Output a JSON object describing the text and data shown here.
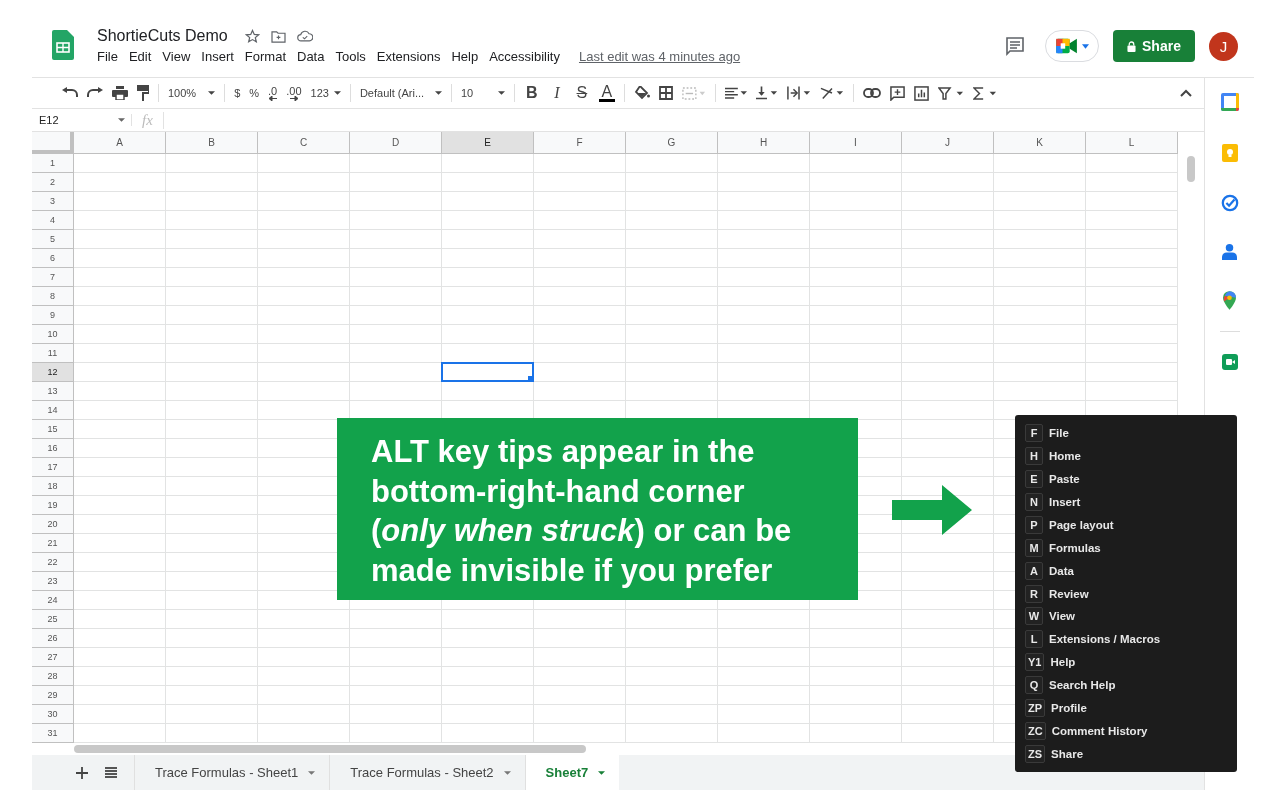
{
  "app": {
    "title": "ShortieCuts Demo",
    "menu": [
      "File",
      "Edit",
      "View",
      "Insert",
      "Format",
      "Data",
      "Tools",
      "Extensions",
      "Help",
      "Accessibility"
    ],
    "last_edit": "Last edit was 4 minutes ago",
    "share_button": "Share",
    "avatar": "J"
  },
  "toolbar": {
    "zoom": "100%",
    "currency": "$",
    "percent": "%",
    "decrease_decimals": ".0",
    "increase_decimals": ".00",
    "more_formats": "123",
    "font": "Default (Ari...",
    "font_size": "10",
    "bold": "B",
    "italic": "I",
    "strikethrough": "S",
    "text_color": "A"
  },
  "formula_bar": {
    "cell_ref": "E12",
    "fx": "fx"
  },
  "columns": [
    {
      "label": "A",
      "selected": false
    },
    {
      "label": "B",
      "selected": false
    },
    {
      "label": "C",
      "selected": false
    },
    {
      "label": "D",
      "selected": false
    },
    {
      "label": "E",
      "selected": true
    },
    {
      "label": "F",
      "selected": false
    },
    {
      "label": "G",
      "selected": false
    },
    {
      "label": "H",
      "selected": false
    },
    {
      "label": "I",
      "selected": false
    },
    {
      "label": "J",
      "selected": false
    },
    {
      "label": "K",
      "selected": false
    },
    {
      "label": "L",
      "selected": false
    }
  ],
  "rows": [
    {
      "label": "1",
      "selected": false
    },
    {
      "label": "2",
      "selected": false
    },
    {
      "label": "3",
      "selected": false
    },
    {
      "label": "4",
      "selected": false
    },
    {
      "label": "5",
      "selected": false
    },
    {
      "label": "6",
      "selected": false
    },
    {
      "label": "7",
      "selected": false
    },
    {
      "label": "8",
      "selected": false
    },
    {
      "label": "9",
      "selected": false
    },
    {
      "label": "10",
      "selected": false
    },
    {
      "label": "11",
      "selected": false
    },
    {
      "label": "12",
      "selected": true
    },
    {
      "label": "13",
      "selected": false
    },
    {
      "label": "14",
      "selected": false
    },
    {
      "label": "15",
      "selected": false
    },
    {
      "label": "16",
      "selected": false
    },
    {
      "label": "17",
      "selected": false
    },
    {
      "label": "18",
      "selected": false
    },
    {
      "label": "19",
      "selected": false
    },
    {
      "label": "20",
      "selected": false
    },
    {
      "label": "21",
      "selected": false
    },
    {
      "label": "22",
      "selected": false
    },
    {
      "label": "23",
      "selected": false
    },
    {
      "label": "24",
      "selected": false
    },
    {
      "label": "25",
      "selected": false
    },
    {
      "label": "26",
      "selected": false
    },
    {
      "label": "27",
      "selected": false
    },
    {
      "label": "28",
      "selected": false
    },
    {
      "label": "29",
      "selected": false
    },
    {
      "label": "30",
      "selected": false
    },
    {
      "label": "31",
      "selected": false
    }
  ],
  "sheet_tabs": [
    {
      "label": "Trace Formulas - Sheet1",
      "selected": false
    },
    {
      "label": "Trace Formulas - Sheet2",
      "selected": false
    },
    {
      "label": "Sheet7",
      "selected": true
    }
  ],
  "callout": {
    "text": "ALT key tips appear in the bottom-right-hand corner (*only when struck*) or can be made invisible if you prefer"
  },
  "key_tips": [
    {
      "key": "F",
      "label": "File"
    },
    {
      "key": "H",
      "label": "Home"
    },
    {
      "key": "E",
      "label": "Paste"
    },
    {
      "key": "N",
      "label": "Insert"
    },
    {
      "key": "P",
      "label": "Page layout"
    },
    {
      "key": "M",
      "label": "Formulas"
    },
    {
      "key": "A",
      "label": "Data"
    },
    {
      "key": "R",
      "label": "Review"
    },
    {
      "key": "W",
      "label": "View"
    },
    {
      "key": "L",
      "label": "Extensions / Macros"
    },
    {
      "key": "Y1",
      "label": "Help"
    },
    {
      "key": "Q",
      "label": "Search Help"
    },
    {
      "key": "ZP",
      "label": "Profile"
    },
    {
      "key": "ZC",
      "label": "Comment History"
    },
    {
      "key": "ZS",
      "label": "Share"
    }
  ]
}
